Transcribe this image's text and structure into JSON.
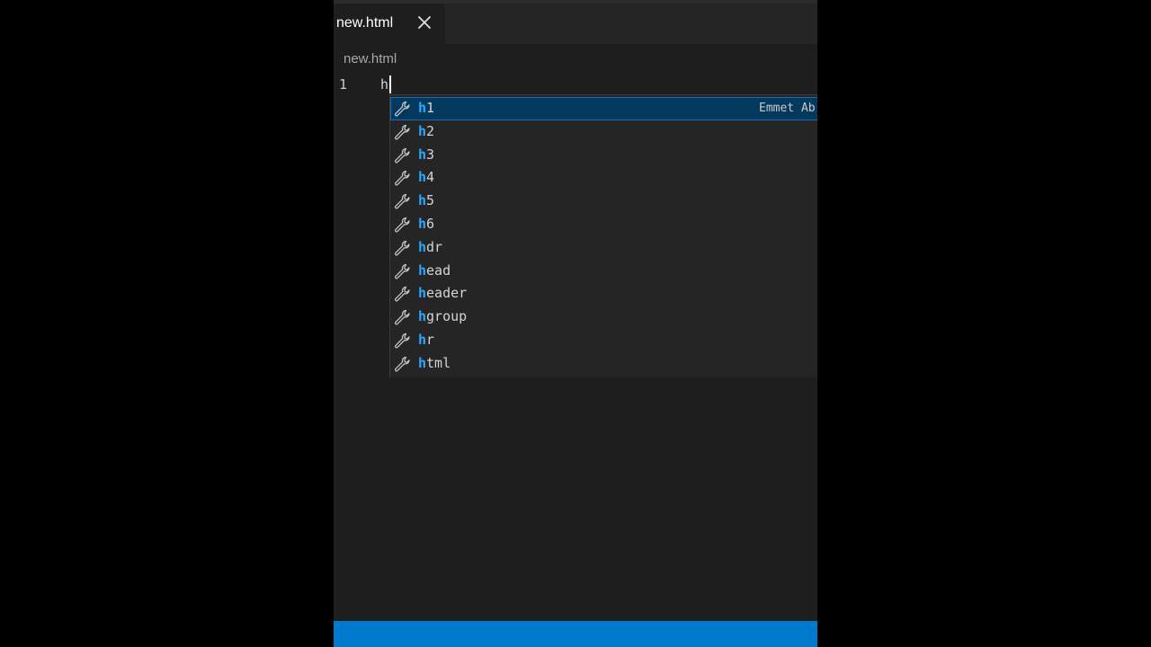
{
  "editor": {
    "tab": {
      "label": "new.html",
      "close_icon": "close-icon"
    },
    "breadcrumb": "new.html",
    "lines": [
      {
        "number": "1",
        "text": "h"
      }
    ]
  },
  "suggest": {
    "query": "h",
    "detail": "Emmet Ab",
    "icon": "wrench-icon",
    "selected_index": 0,
    "items": [
      {
        "match": "h",
        "rest": "1"
      },
      {
        "match": "h",
        "rest": "2"
      },
      {
        "match": "h",
        "rest": "3"
      },
      {
        "match": "h",
        "rest": "4"
      },
      {
        "match": "h",
        "rest": "5"
      },
      {
        "match": "h",
        "rest": "6"
      },
      {
        "match": "h",
        "rest": "dr"
      },
      {
        "match": "h",
        "rest": "ead"
      },
      {
        "match": "h",
        "rest": "eader"
      },
      {
        "match": "h",
        "rest": "group"
      },
      {
        "match": "h",
        "rest": "r"
      },
      {
        "match": "h",
        "rest": "tml"
      }
    ]
  },
  "colors": {
    "status_bar": "#007acc",
    "selection_bg": "#04395e",
    "match_highlight": "#2aaaff"
  }
}
